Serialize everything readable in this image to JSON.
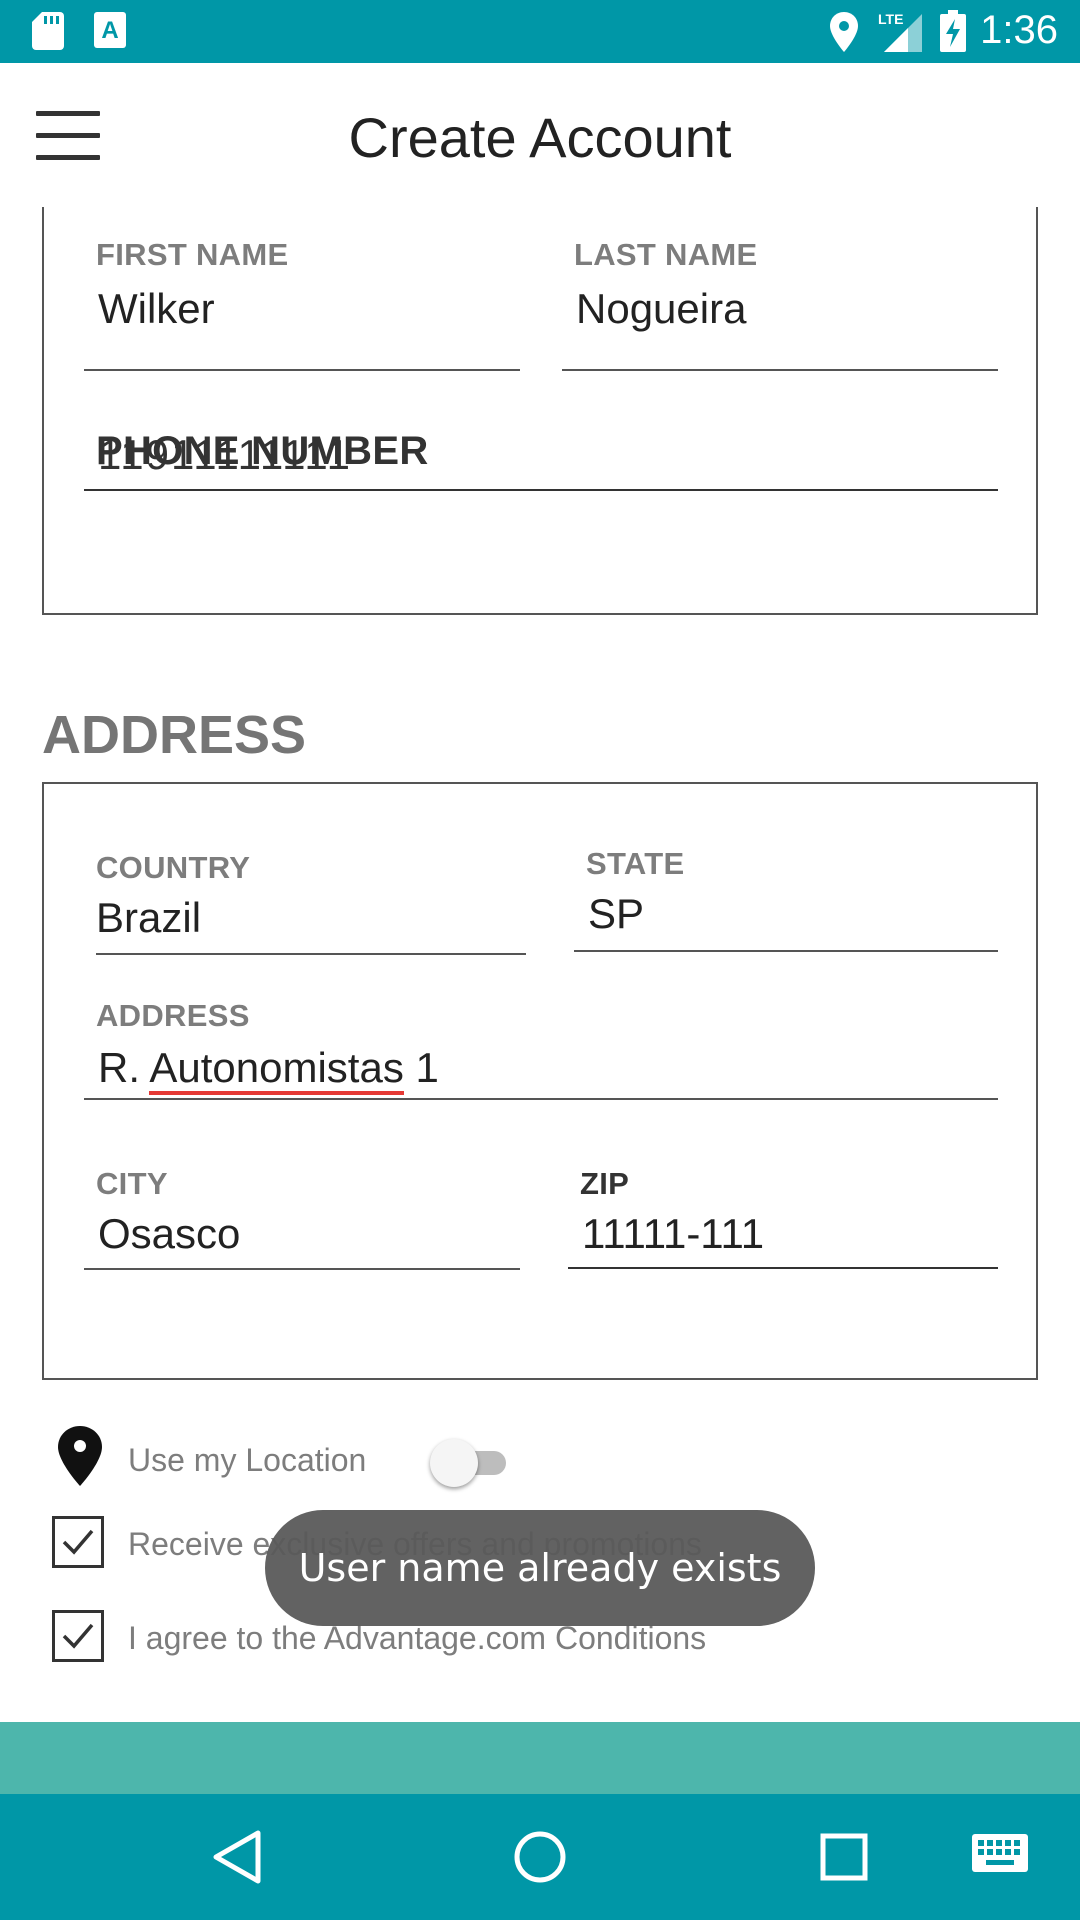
{
  "status_bar": {
    "time": "1:36",
    "left_icons": [
      "sd-card-icon",
      "a-app-icon"
    ],
    "right_icons": [
      "location-icon",
      "lte-signal-icon",
      "battery-charging-icon"
    ],
    "network": "LTE"
  },
  "app_bar": {
    "title": "Create Account",
    "menu_icon": "hamburger-menu-icon"
  },
  "personal": {
    "first_name": {
      "label": "FIRST NAME",
      "value": "Wilker"
    },
    "last_name": {
      "label": "LAST NAME",
      "value": "Nogueira"
    },
    "phone": {
      "label": "PHONE NUMBER",
      "value": "11911111111"
    }
  },
  "address_section": {
    "title": "ADDRESS",
    "country": {
      "label": "COUNTRY",
      "value": "Brazil"
    },
    "state": {
      "label": "STATE",
      "value": "SP"
    },
    "address": {
      "label": "ADDRESS",
      "value_prefix": "R. ",
      "value_misspelled": "Autonomistas",
      "value_suffix": " 1"
    },
    "city": {
      "label": "CITY",
      "value": "Osasco"
    },
    "zip": {
      "label": "ZIP",
      "value": "11111-111"
    }
  },
  "options": {
    "use_location": {
      "label": "Use my Location",
      "enabled": false
    },
    "offers": {
      "label": "Receive exclusive offers and promotions",
      "checked": true
    },
    "agree": {
      "label": "I agree to the Advantage.com Conditions",
      "checked": true
    }
  },
  "toast": {
    "message": "User name already exists"
  },
  "colors": {
    "primary": "#0097a7",
    "accent_strip": "#4db6ac",
    "label_gray": "#7d7d7d",
    "toast_bg": "#5a5a5a"
  },
  "nav_bar": {
    "icons": [
      "back-icon",
      "home-icon",
      "recents-icon",
      "keyboard-icon"
    ]
  }
}
